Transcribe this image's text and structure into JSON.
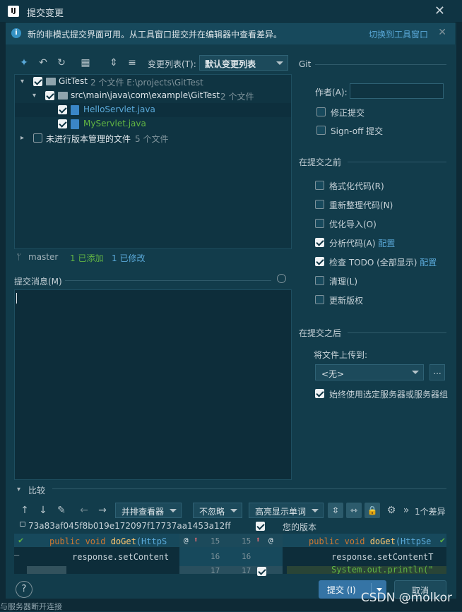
{
  "window": {
    "title": "提交变更",
    "app_icon": "IJ"
  },
  "banner": {
    "text": "新的非模式提交界面可用。从工具窗口提交并在编辑器中查看差异。",
    "link": "切换到工具窗口"
  },
  "toolbar": {
    "changelist_label": "变更列表(T):",
    "changelist_value": "默认变更列表"
  },
  "tree": {
    "root": {
      "name": "GitTest",
      "meta": "2 个文件  E:\\projects\\GitTest"
    },
    "package": {
      "name": "src\\main\\java\\com\\example\\GitTest",
      "meta": "2 个文件"
    },
    "files": [
      {
        "name": "HelloServlet.java"
      },
      {
        "name": "MyServlet.java"
      }
    ],
    "unversioned": {
      "name": "未进行版本管理的文件",
      "meta": "5 个文件"
    }
  },
  "status": {
    "branch": "master",
    "added": "1 已添加",
    "modified": "1 已修改"
  },
  "commit_message": {
    "label": "提交消息(M)",
    "value": ""
  },
  "git": {
    "title": "Git",
    "author_label": "作者(A):",
    "author_value": "",
    "amend": "修正提交",
    "signoff": "Sign-off 提交"
  },
  "before_commit": {
    "title": "在提交之前",
    "options": [
      {
        "label": "格式化代码(R)",
        "checked": false
      },
      {
        "label": "重新整理代码(N)",
        "checked": false
      },
      {
        "label": "优化导入(O)",
        "checked": false
      },
      {
        "label": "分析代码(A)",
        "checked": true,
        "link": "配置"
      },
      {
        "label": "检查 TODO (全部显示)",
        "checked": true,
        "link": "配置"
      },
      {
        "label": "清理(L)",
        "checked": false
      },
      {
        "label": "更新版权",
        "checked": false
      }
    ]
  },
  "after_commit": {
    "title": "在提交之后",
    "upload_label": "将文件上传到:",
    "upload_value": "<无>",
    "always_use": "始终使用选定服务器或服务器组"
  },
  "compare": {
    "title": "比较",
    "viewer": "并排查看器",
    "ignore": "不忽略",
    "highlight": "高亮显示单词",
    "diff_count": "1个差异",
    "hash": "73a83af045f8b019e172097f17737aa1453a12ff",
    "your_version": "您的版本",
    "left_code": [
      "public void doGet(HttpS",
      "response.setContent"
    ],
    "right_code": [
      "public void doGet(HttpSe",
      "response.setContentT",
      "System.out.println(\""
    ],
    "line_numbers_left": [
      "15",
      "16",
      "17"
    ],
    "line_numbers_right": [
      "15",
      "16",
      "17"
    ]
  },
  "footer": {
    "help": "?",
    "commit": "提交 (I)",
    "cancel": "取消",
    "watermark": "CSDN @molkor",
    "behind_text": "与服务器断开连接"
  }
}
